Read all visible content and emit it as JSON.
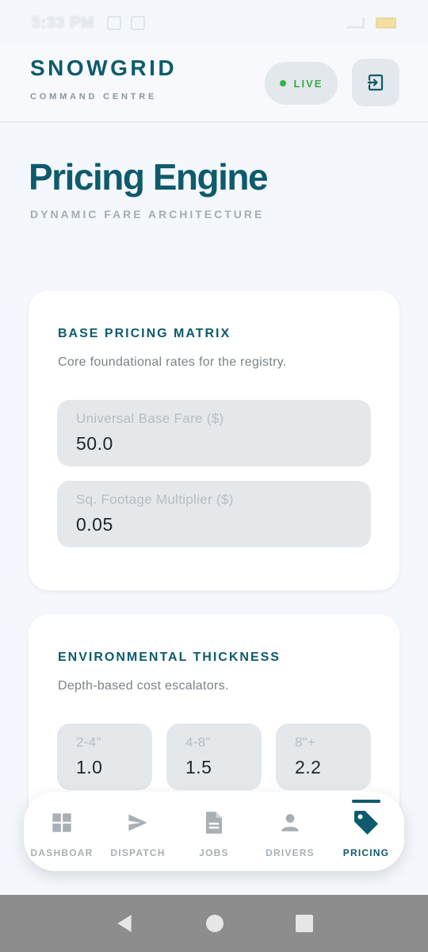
{
  "status_bar": {
    "time": "5:33 PM"
  },
  "header": {
    "brand_name": "SNOWGRID",
    "brand_sub": "COMMAND CENTRE",
    "live_label": "LIVE"
  },
  "page": {
    "title": "Pricing Engine",
    "subtitle": "DYNAMIC FARE ARCHITECTURE"
  },
  "base_pricing": {
    "title": "BASE PRICING MATRIX",
    "description": "Core foundational rates for the registry.",
    "fields": [
      {
        "label": "Universal Base Fare ($)",
        "value": "50.0"
      },
      {
        "label": "Sq. Footage Multiplier ($)",
        "value": "0.05"
      }
    ]
  },
  "thickness": {
    "title": "ENVIRONMENTAL THICKNESS",
    "description": "Depth-based cost escalators.",
    "fields": [
      {
        "label": "2-4\"",
        "value": "1.0"
      },
      {
        "label": "4-8\"",
        "value": "1.5"
      },
      {
        "label": "8\"+",
        "value": "2.2"
      }
    ]
  },
  "nav": {
    "items": [
      {
        "label": "DASHBOAR",
        "icon": "grid-icon"
      },
      {
        "label": "DISPATCH",
        "icon": "send-icon"
      },
      {
        "label": "JOBS",
        "icon": "document-icon"
      },
      {
        "label": "DRIVERS",
        "icon": "person-icon"
      },
      {
        "label": "PRICING",
        "icon": "tag-icon"
      }
    ],
    "active": "PRICING"
  },
  "colors": {
    "brand": "#0d5b6c",
    "live": "#37b24d",
    "background": "#f4f7fb",
    "field_bg": "#e5e8eb"
  }
}
